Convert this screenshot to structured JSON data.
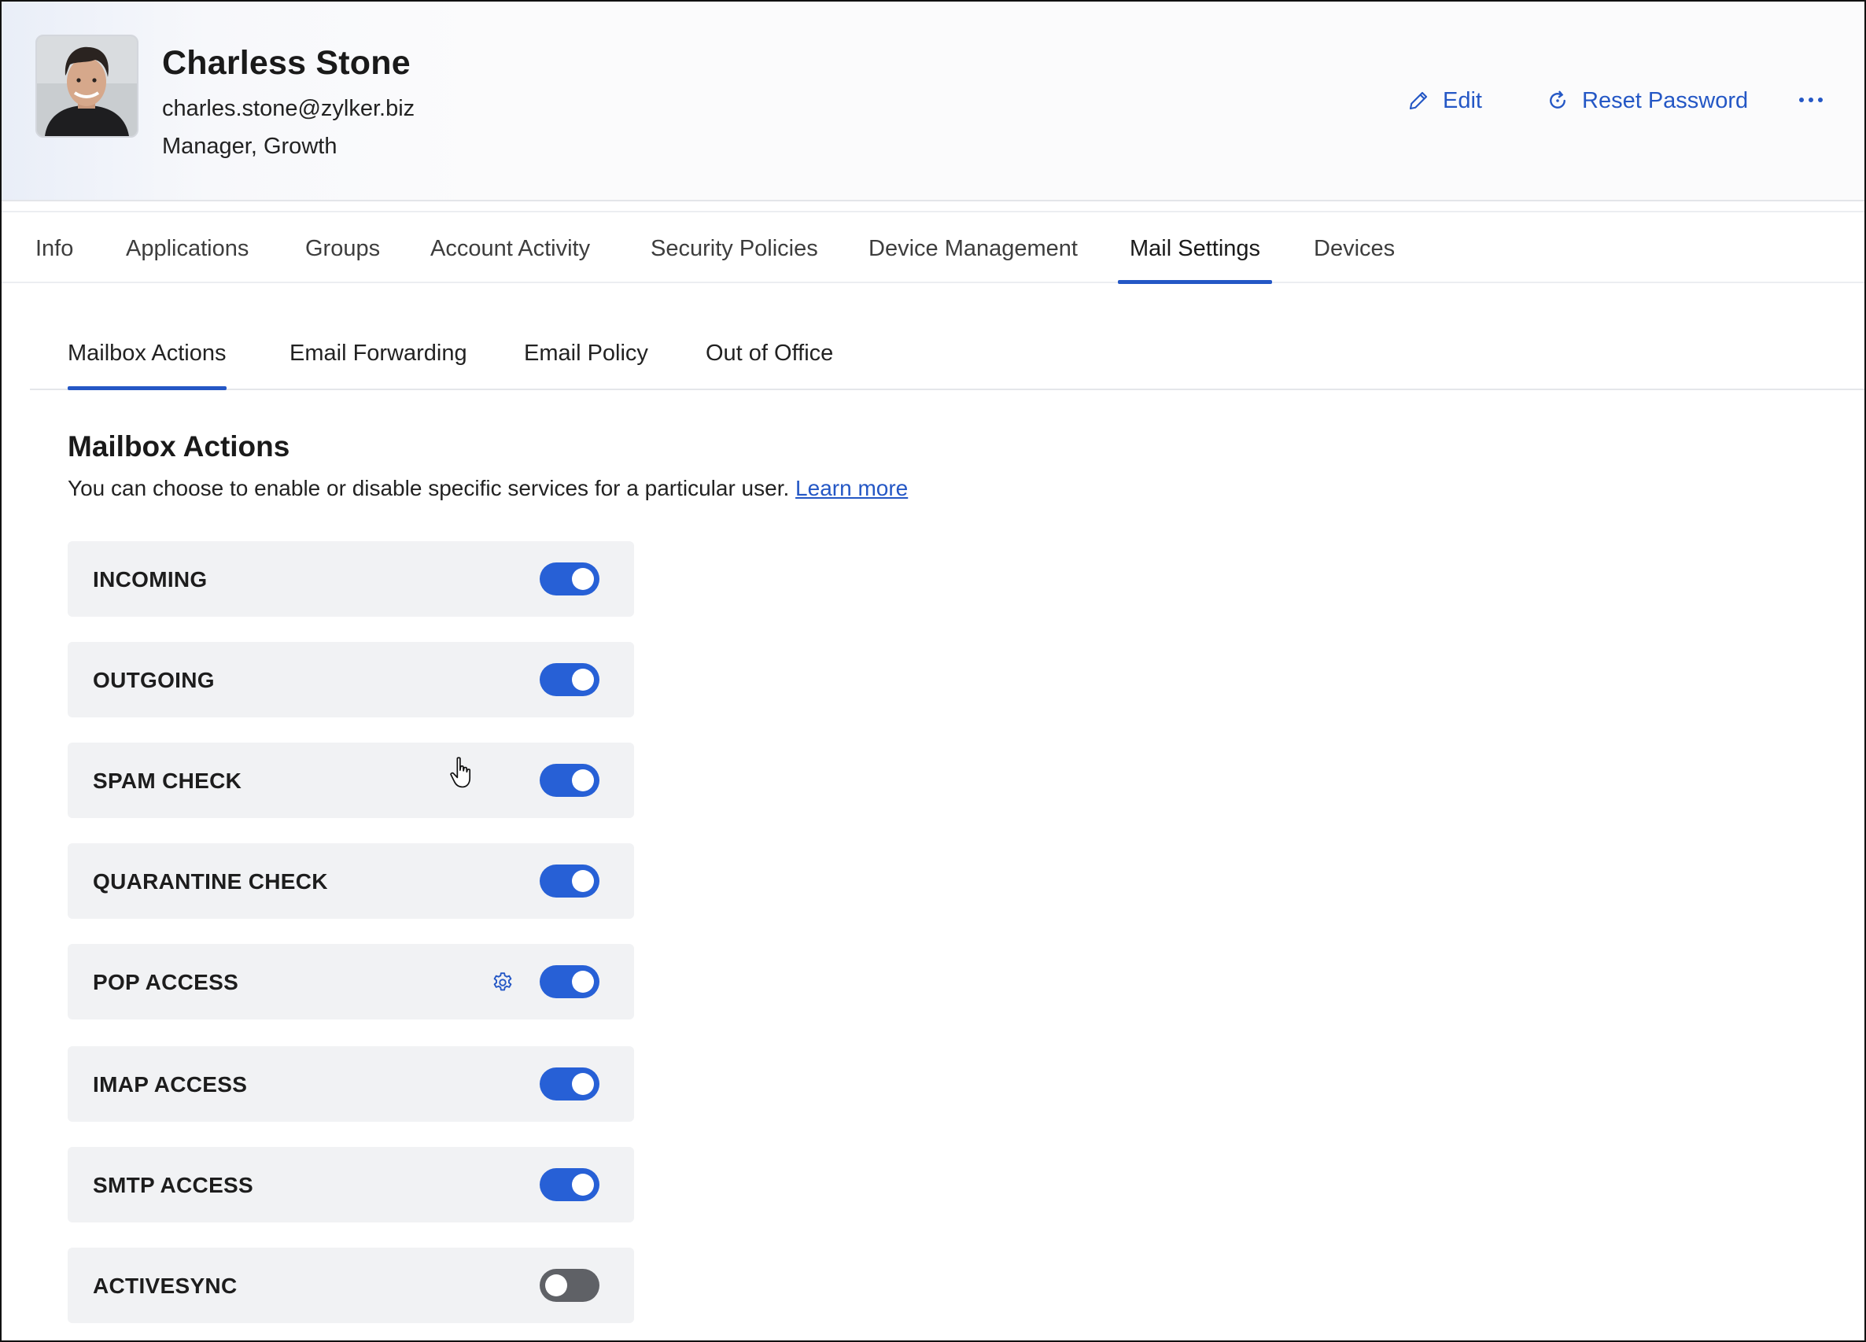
{
  "user": {
    "name": "Charless Stone",
    "email": "charles.stone@zylker.biz",
    "role": "Manager, Growth"
  },
  "header_actions": {
    "edit_label": "Edit",
    "reset_password_label": "Reset Password",
    "more_icon": "more-horizontal-icon"
  },
  "tabs": [
    {
      "label": "Info",
      "active": false
    },
    {
      "label": "Applications",
      "active": false
    },
    {
      "label": "Groups",
      "active": false
    },
    {
      "label": "Account Activity",
      "active": false
    },
    {
      "label": "Security Policies",
      "active": false
    },
    {
      "label": "Device Management",
      "active": false
    },
    {
      "label": "Mail Settings",
      "active": true
    },
    {
      "label": "Devices",
      "active": false
    }
  ],
  "subtabs": [
    {
      "label": "Mailbox Actions",
      "active": true
    },
    {
      "label": "Email Forwarding",
      "active": false
    },
    {
      "label": "Email Policy",
      "active": false
    },
    {
      "label": "Out of Office",
      "active": false
    }
  ],
  "section": {
    "title": "Mailbox Actions",
    "description": "You can choose to enable or disable specific services for a particular user.",
    "learn_more": "Learn more"
  },
  "options": [
    {
      "label": "INCOMING",
      "enabled": true
    },
    {
      "label": "OUTGOING",
      "enabled": true
    },
    {
      "label": "SPAM CHECK",
      "enabled": true
    },
    {
      "label": "QUARANTINE CHECK",
      "enabled": true
    },
    {
      "label": "POP ACCESS",
      "enabled": true,
      "settings_icon": "gear-icon"
    },
    {
      "label": "IMAP ACCESS",
      "enabled": true
    },
    {
      "label": "SMTP ACCESS",
      "enabled": true
    },
    {
      "label": "ACTIVESYNC",
      "enabled": false
    }
  ],
  "colors": {
    "accent": "#2457c5",
    "toggle_on": "#2760d6",
    "toggle_off": "#5f6166",
    "row_background": "#f1f2f4"
  }
}
